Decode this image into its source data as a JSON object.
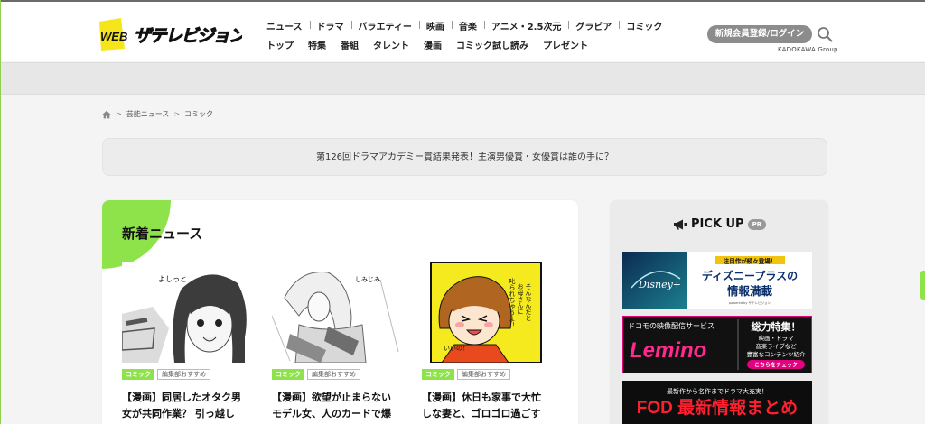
{
  "brand": {
    "logo_web": "WEB",
    "logo_main": "ザテレビジョン",
    "group": "KADOKAWA Group",
    "accent": "#8ee34a",
    "logo_red": "#e8141a",
    "logo_yellow": "#f5e51b"
  },
  "nav": {
    "row1": [
      "ニュース",
      "ドラマ",
      "バラエティー",
      "映画",
      "音楽",
      "アニメ・2.5次元",
      "グラビア",
      "コミック"
    ],
    "row2": [
      "トップ",
      "特集",
      "番組",
      "タレント",
      "漫画",
      "コミック試し読み",
      "プレゼント"
    ]
  },
  "header": {
    "login_label": "新規会員登録/ログイン",
    "search_icon": "search-icon"
  },
  "breadcrumb": {
    "home_icon": "home-icon",
    "items": [
      "芸能ニュース",
      "コミック"
    ]
  },
  "announcement": "第126回ドラマアカデミー賞結果発表！主演男優賞・女優賞は誰の手に？",
  "news": {
    "title": "新着ニュース",
    "cards": [
      {
        "tag": "コミック",
        "tag2": "編集部おすすめ",
        "headline_l1": "【漫画】同居したオタク男",
        "headline_l2": "女が共同作業？ 引っ越し",
        "manga_text": "よしっと"
      },
      {
        "tag": "コミック",
        "tag2": "編集部おすすめ",
        "headline_l1": "【漫画】欲望が止まらない",
        "headline_l2": "モデル女、人のカードで爆",
        "manga_text": "しみじみ"
      },
      {
        "tag": "コミック",
        "tag2": "編集部おすすめ",
        "headline_l1": "【漫画】休日も家事で大忙",
        "headline_l2": "しな妻と、ゴロゴロ過ごす",
        "manga_text_1": "そんなんだと",
        "manga_text_2": "お母さんに",
        "manga_text_3": "叱られちゃうよ！",
        "manga_text_4": "いいの！"
      }
    ]
  },
  "pickup": {
    "title": "PICK UP",
    "badge": "PR",
    "megaphone_icon": "megaphone-icon",
    "banners": [
      {
        "name": "disney-plus",
        "logo": "Disney+",
        "kicker": "注目作が続々登場！",
        "line1": "ディズニープラスの",
        "line2": "情報満載",
        "footer": "powered by ザテレビジョン"
      },
      {
        "name": "lemino",
        "kicker": "ドコモの映像配信サービス",
        "logo": "Lemino",
        "title": "総力特集！",
        "sub1": "映画・ドラマ",
        "sub2": "音楽ライブなど",
        "sub3": "豊富なコンテンツ紹介",
        "cta": "こちらをチェック"
      },
      {
        "name": "fod",
        "kicker": "最新作から名作までドラマ大充実！",
        "title": "FOD 最新情報まとめ"
      }
    ]
  }
}
